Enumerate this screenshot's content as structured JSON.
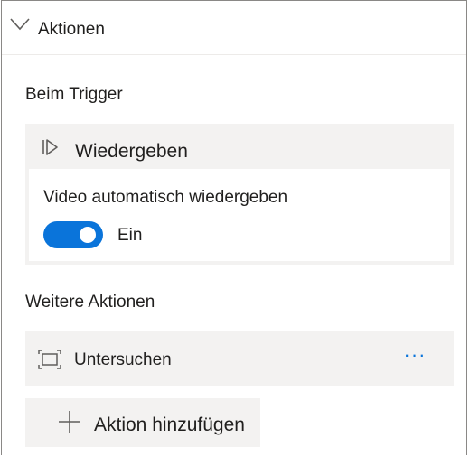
{
  "section": {
    "title": "Aktionen",
    "chevron_icon": "chevron-down-icon"
  },
  "trigger_group": {
    "label": "Beim Trigger",
    "card": {
      "icon": "play-icon",
      "title": "Wiedergeben",
      "setting": {
        "label": "Video automatisch wiedergeben",
        "toggle_on": true,
        "state_text": "Ein",
        "accent_color": "#0a74da"
      }
    }
  },
  "more_actions": {
    "label": "Weitere Aktionen",
    "items": [
      {
        "icon": "expand-frame-icon",
        "label": "Untersuchen",
        "more_icon": "more-dots-icon",
        "more_text": "···"
      }
    ]
  },
  "add_action": {
    "icon": "plus-icon",
    "label": "Aktion hinzufügen"
  }
}
